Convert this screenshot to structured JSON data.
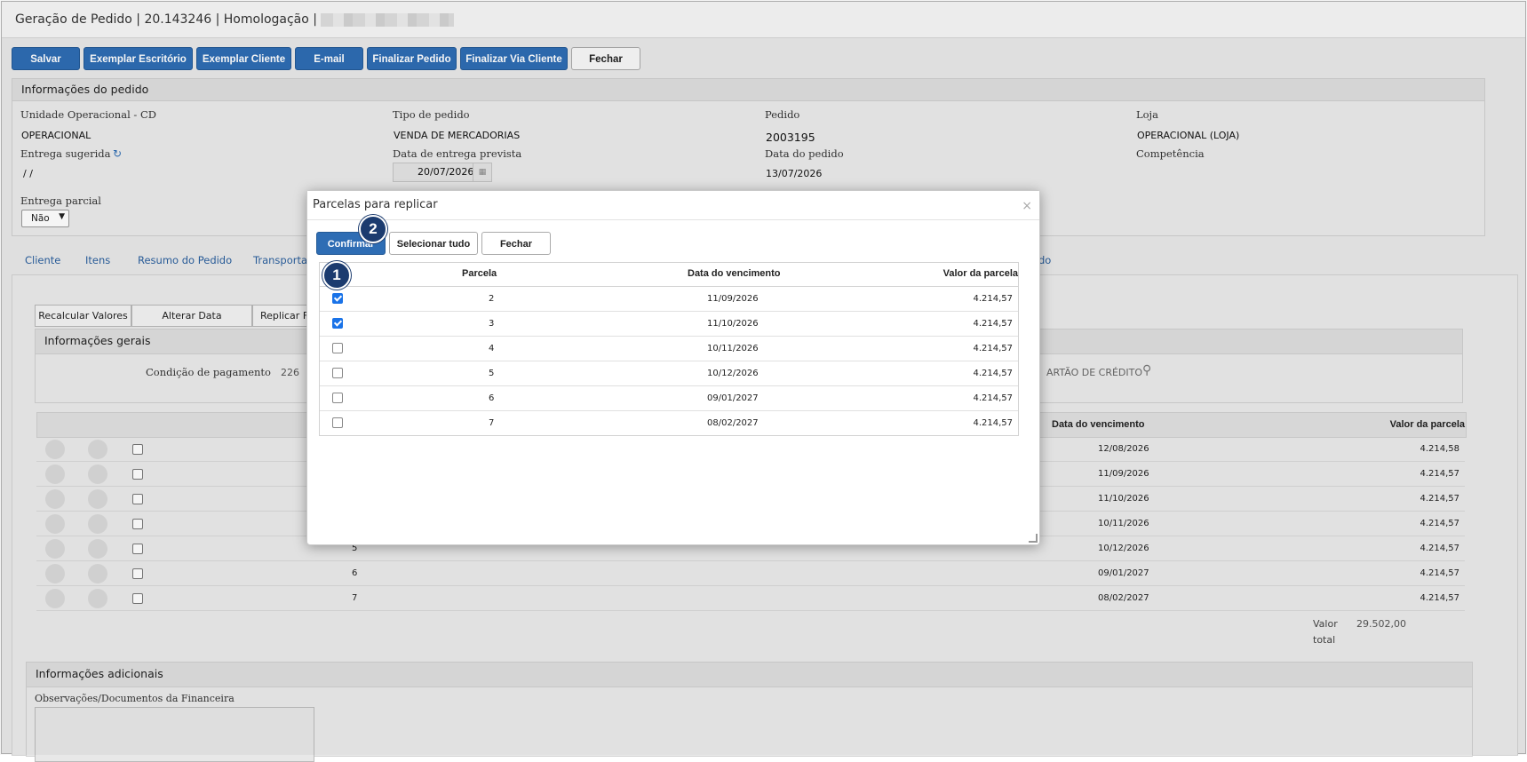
{
  "window": {
    "title": "Geração de Pedido | 20.143246 | Homologação |"
  },
  "toolbar": {
    "buttons": [
      "Salvar",
      "Exemplar Escritório",
      "Exemplar Cliente",
      "E-mail",
      "Finalizar Pedido",
      "Finalizar Via Cliente",
      "Fechar"
    ]
  },
  "order_info": {
    "heading": "Informações do pedido",
    "fields": {
      "unidade_label": "Unidade Operacional - CD",
      "unidade_value": "OPERACIONAL",
      "tipo_label": "Tipo de pedido",
      "tipo_value": "VENDA DE MERCADORIAS",
      "pedido_label": "Pedido",
      "pedido_value": "2003195",
      "loja_label": "Loja",
      "loja_value": "OPERACIONAL (LOJA)",
      "entrega_sugerida_label": "Entrega sugerida",
      "entrega_sugerida_value": "/ /",
      "data_entrega_label": "Data de entrega prevista",
      "data_entrega_value": "20/07/2026",
      "data_pedido_label": "Data do pedido",
      "data_pedido_value": "13/07/2026",
      "competencia_label": "Competência",
      "entrega_parcial_label": "Entrega parcial",
      "entrega_parcial_value": "Não"
    }
  },
  "tabs": [
    "Cliente",
    "Itens",
    "Resumo do Pedido",
    "Transportac",
    "do"
  ],
  "payment": {
    "buttons": [
      "Recalcular Valores",
      "Alterar Data Vencimento",
      "Replicar Fo"
    ],
    "general_heading": "Informações gerais",
    "condicao_label": "Condição de pagamento",
    "condicao_value": "226",
    "cartao_text": "ARTÃO DE CRÉDITO",
    "col_data": "Data do vencimento",
    "col_valor": "Valor da parcela",
    "rows": [
      {
        "parcela": "",
        "data": "12/08/2026",
        "valor": "4.214,58"
      },
      {
        "parcela": "",
        "data": "11/09/2026",
        "valor": "4.214,57"
      },
      {
        "parcela": "",
        "data": "11/10/2026",
        "valor": "4.214,57"
      },
      {
        "parcela": "",
        "data": "10/11/2026",
        "valor": "4.214,57"
      },
      {
        "parcela": "5",
        "data": "10/12/2026",
        "valor": "4.214,57"
      },
      {
        "parcela": "6",
        "data": "09/01/2027",
        "valor": "4.214,57"
      },
      {
        "parcela": "7",
        "data": "08/02/2027",
        "valor": "4.214,57"
      }
    ],
    "total_label_1": "Valor",
    "total_label_2": "total",
    "total_value": "29.502,00"
  },
  "additional": {
    "heading": "Informações adicionais",
    "obs_label": "Observações/Documentos da Financeira"
  },
  "modal": {
    "title": "Parcelas para replicar",
    "close_glyph": "×",
    "buttons": [
      "Confirmar",
      "Selecionar tudo",
      "Fechar"
    ],
    "columns": [
      "Parcela",
      "Data do vencimento",
      "Valor da parcela"
    ],
    "rows": [
      {
        "parcela": "2",
        "data": "11/09/2026",
        "valor": "4.214,57",
        "checked": true
      },
      {
        "parcela": "3",
        "data": "11/10/2026",
        "valor": "4.214,57",
        "checked": true
      },
      {
        "parcela": "4",
        "data": "10/11/2026",
        "valor": "4.214,57",
        "checked": false
      },
      {
        "parcela": "5",
        "data": "10/12/2026",
        "valor": "4.214,57",
        "checked": false
      },
      {
        "parcela": "6",
        "data": "09/01/2027",
        "valor": "4.214,57",
        "checked": false
      },
      {
        "parcela": "7",
        "data": "08/02/2027",
        "valor": "4.214,57",
        "checked": false
      }
    ]
  },
  "badges": [
    "1",
    "2"
  ],
  "colors": {
    "primary": "#2e6db4",
    "badge": "#1b3b6f",
    "link": "#2a5f9e"
  }
}
